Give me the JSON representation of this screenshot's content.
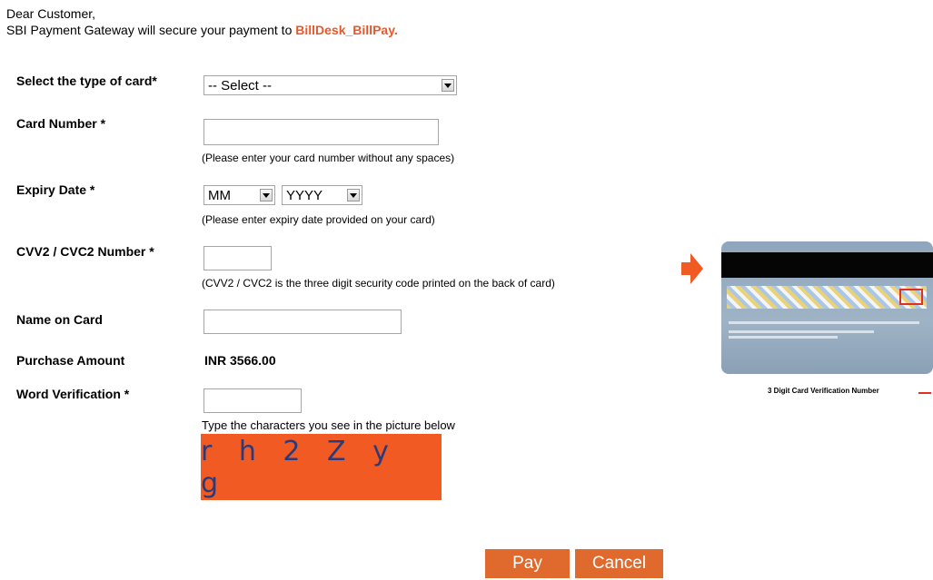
{
  "intro": {
    "greeting": "Dear Customer,",
    "line_prefix": "SBI Payment Gateway will secure your payment to ",
    "merchant": "BillDesk_BillPay."
  },
  "form": {
    "card_type": {
      "label": "Select the type of card*",
      "value": "-- Select --"
    },
    "card_number": {
      "label": "Card Number *",
      "value": "",
      "hint": "(Please enter your card number without any spaces)"
    },
    "expiry": {
      "label": "Expiry Date *",
      "month": "MM",
      "year": "YYYY",
      "hint": "(Please enter expiry date provided on your card)"
    },
    "cvv": {
      "label": "CVV2 / CVC2 Number *",
      "value": "",
      "hint": "(CVV2 / CVC2 is the three digit security code printed on the back of card)"
    },
    "name": {
      "label": "Name on Card",
      "value": ""
    },
    "amount": {
      "label": "Purchase Amount",
      "value": "INR  3566.00"
    },
    "word_verification": {
      "label": "Word Verification *",
      "value": "",
      "hint": "Type the characters you see in the picture below",
      "captcha_text": "r h 2 Z y g"
    }
  },
  "card_illustration": {
    "caption": "3 Digit Card Verification Number"
  },
  "buttons": {
    "pay": "Pay",
    "cancel": "Cancel"
  },
  "colors": {
    "accent": "#f15a22",
    "button": "#e06a2e",
    "merchant_text": "#e8582a"
  }
}
